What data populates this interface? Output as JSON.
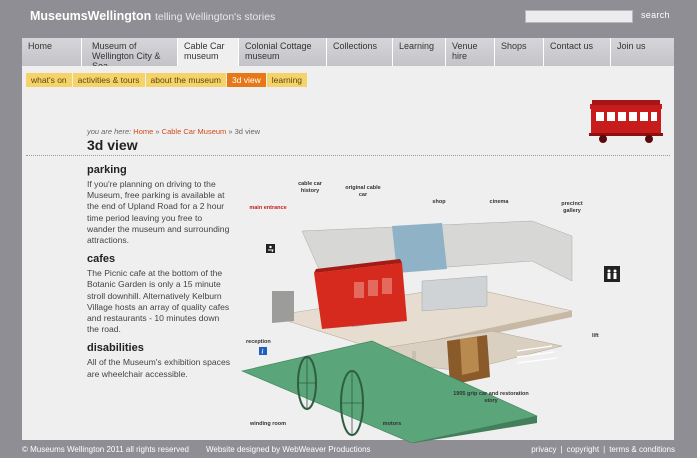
{
  "header": {
    "brand": "MuseumsWellington",
    "tagline": "telling Wellington's stories",
    "search_label": "search"
  },
  "nav": [
    {
      "line1": "Home",
      "line2": ""
    },
    {
      "line1": "Museum of",
      "line2": "Wellington City & Sea"
    },
    {
      "line1": "Cable Car",
      "line2": "museum"
    },
    {
      "line1": "Colonial Cottage",
      "line2": "museum"
    },
    {
      "line1": "Collections",
      "line2": ""
    },
    {
      "line1": "Learning",
      "line2": ""
    },
    {
      "line1": "Venue",
      "line2": "hire"
    },
    {
      "line1": "Shops",
      "line2": ""
    },
    {
      "line1": "Contact us",
      "line2": ""
    },
    {
      "line1": "Join us",
      "line2": ""
    }
  ],
  "subnav": [
    "what's on",
    "activities & tours",
    "about the museum",
    "3d view",
    "learning"
  ],
  "breadcrumb": {
    "prefix": "you are here:",
    "home": "Home",
    "sep1": "»",
    "parent": "Cable Car Museum",
    "sep2": "»",
    "current": "3d view"
  },
  "page_title": "3d view",
  "sections": [
    {
      "heading": "parking",
      "body": "If you're planning on driving to the Museum, free parking is available at the end of Upland Road for a 2 hour time period leaving you free to wander the museum and surrounding attractions."
    },
    {
      "heading": "cafes",
      "body": "The Picnic cafe at the bottom of the Botanic Garden is only a 15 minute stroll downhill. Alternatively Kelburn Village hosts an array of quality cafes and restaurants - 10 minutes down the road."
    },
    {
      "heading": "disabilities",
      "body": "All of the Museum's exhibition spaces are wheelchair accessible."
    }
  ],
  "diagram_labels": {
    "cable_car_history": "cable car history",
    "original_cable_car": "original cable car",
    "shop": "shop",
    "cinema": "cinema",
    "precinct_gallery": "precinct gallery",
    "main_entrance": "main entrance",
    "reception": "reception",
    "lift": "lift",
    "winding_room": "winding room",
    "grip_car": "1905 grip car and restoration story",
    "motors": "motors"
  },
  "footer": {
    "copyright": "© Museums Wellington 2011 all rights reserved",
    "designer": "Website designed by WebWeaver Productions",
    "links": [
      "privacy",
      "copyright",
      "terms & conditions"
    ],
    "separator": "|"
  },
  "colors": {
    "background": "#8e8e94",
    "panel": "#efefef",
    "subnav": "#f6d36a",
    "subnav_active": "#e67817",
    "accent_red": "#c81b1b",
    "floor_green": "#5aa57a"
  }
}
